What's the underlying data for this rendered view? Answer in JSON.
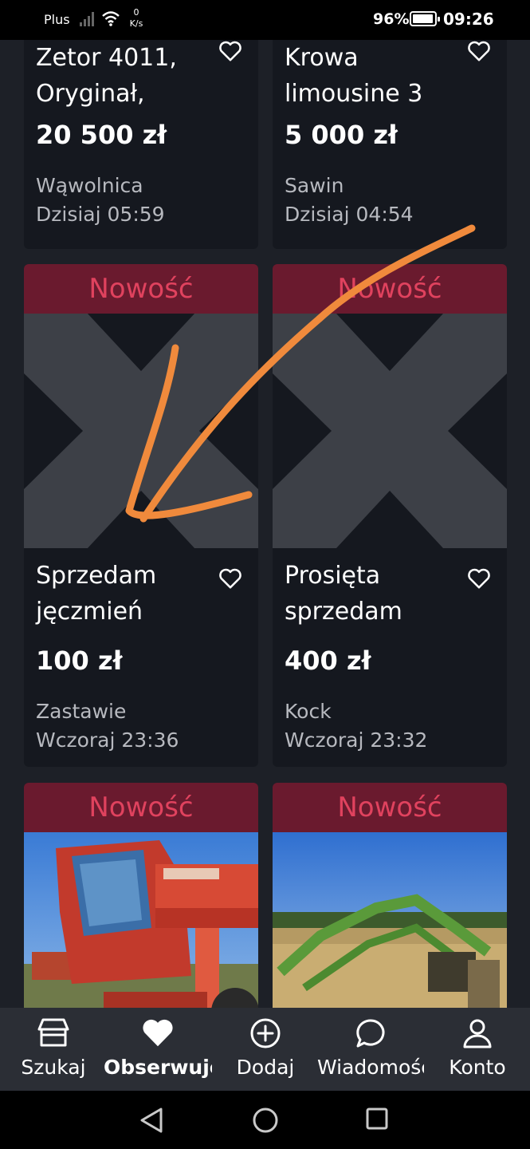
{
  "status_bar": {
    "carrier": "Plus",
    "net_speed_value": "0",
    "net_speed_unit": "K/s",
    "battery": "96%",
    "battery_level": 0.96,
    "time": "09:26"
  },
  "badge_label": "Nowość",
  "listings": [
    {
      "title": "Zetor 4011, Oryginał,",
      "price": "20 500 zł",
      "location": "Wąwolnica",
      "date": "Dzisiaj 05:59"
    },
    {
      "title": "Krowa limousine 3",
      "price": "5 000 zł",
      "location": "Sawin",
      "date": "Dzisiaj 04:54"
    },
    {
      "title": "Sprzedam jęczmień",
      "price": "100 zł",
      "location": "Zastawie",
      "date": "Wczoraj 23:36"
    },
    {
      "title": "Prosięta sprzedam",
      "price": "400 zł",
      "location": "Kock",
      "date": "Wczoraj 23:32"
    }
  ],
  "bottom_nav": [
    {
      "label": "Szukaj",
      "icon": "shop-icon"
    },
    {
      "label": "Obserwuje",
      "icon": "heart-icon",
      "active": true
    },
    {
      "label": "Dodaj",
      "icon": "plus-circle-icon"
    },
    {
      "label": "Wiadomości",
      "icon": "chat-icon"
    },
    {
      "label": "Konto",
      "icon": "user-icon"
    }
  ],
  "colors": {
    "background": "#1d2027",
    "card": "#15181f",
    "badge_bg": "#6a1a2e",
    "badge_text": "#e0425e",
    "annotation_arrow": "#f08a3c"
  }
}
